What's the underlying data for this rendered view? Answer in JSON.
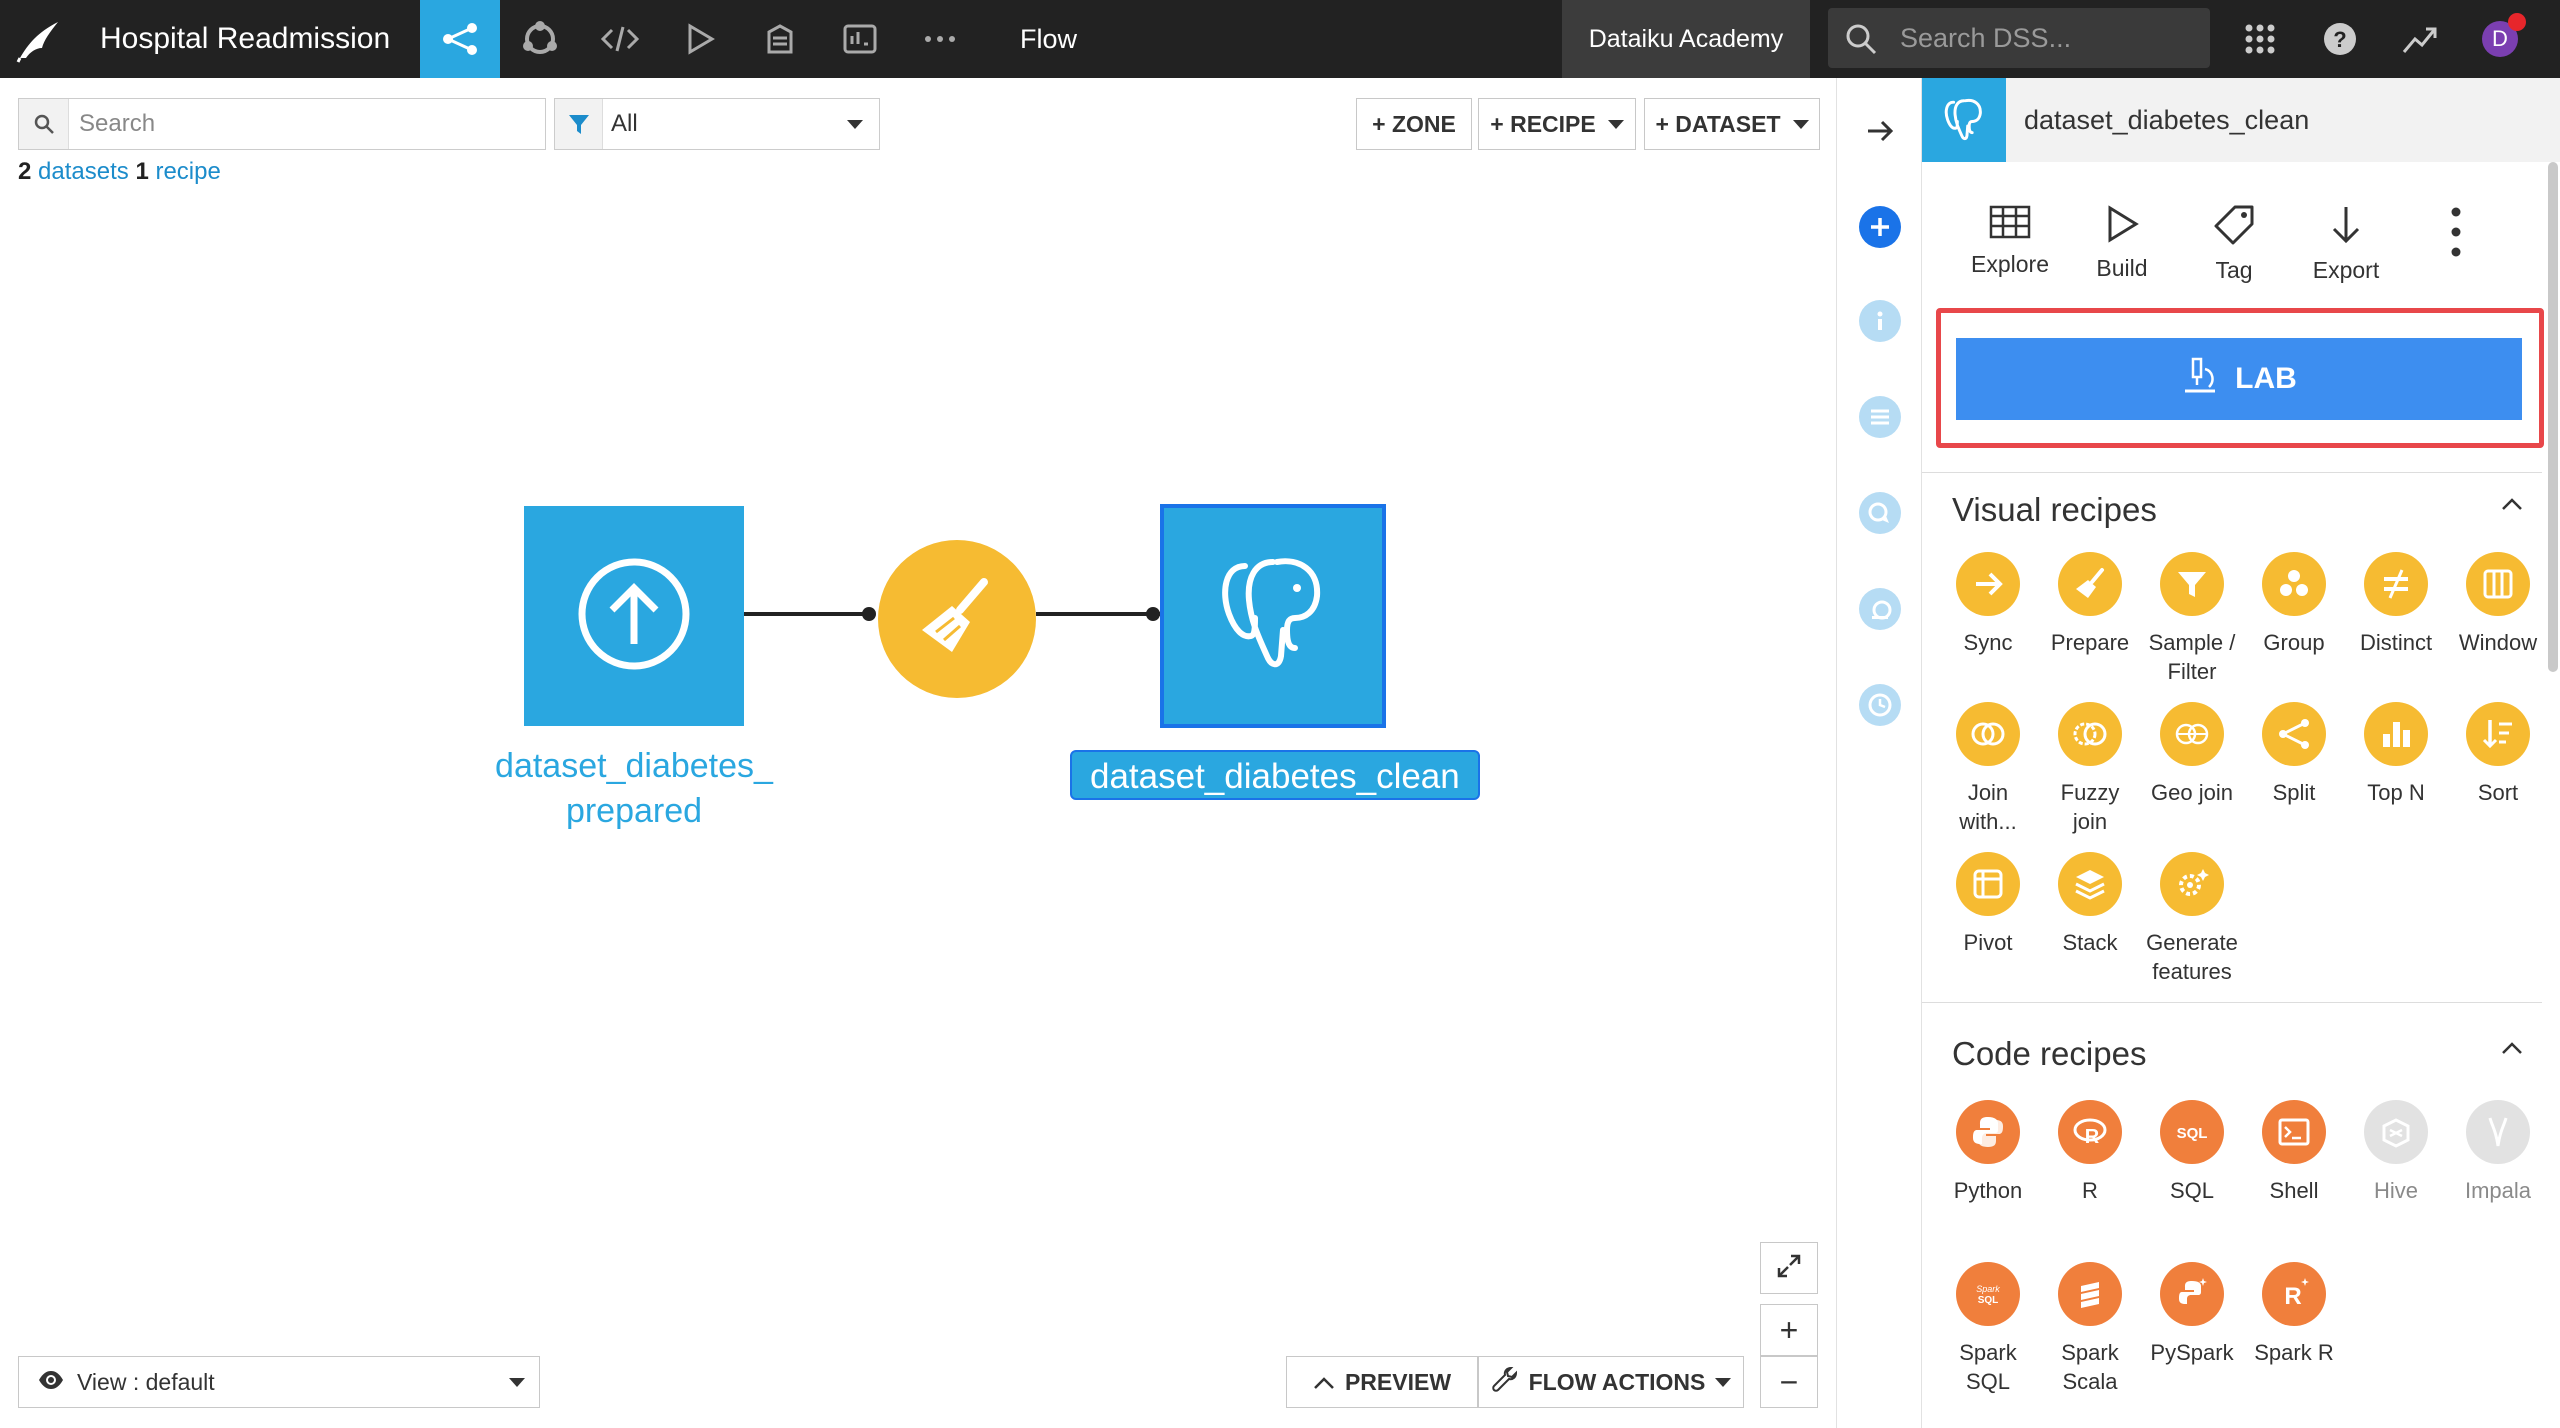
{
  "topbar": {
    "project_name": "Hospital Readmission",
    "section_label": "Flow",
    "instance_label": "Dataiku Academy",
    "search_placeholder": "Search DSS...",
    "avatar_initial": "D"
  },
  "flow_toolbar": {
    "search_placeholder": "Search",
    "filter_value": "All",
    "zone_button": "+ ZONE",
    "recipe_button": "+ RECIPE",
    "dataset_button": "+ DATASET"
  },
  "counts": {
    "datasets_count": "2",
    "datasets_label": "datasets",
    "recipes_count": "1",
    "recipes_label": "recipe"
  },
  "flow": {
    "input_dataset_label": "dataset_diabetes_\nprepared",
    "output_dataset_label": "dataset_diabetes_clean"
  },
  "bottom": {
    "view_label": "View : default",
    "preview_button": "PREVIEW",
    "flow_actions_button": "FLOW ACTIONS",
    "zoom_in": "+",
    "zoom_out": "−"
  },
  "panel": {
    "title": "dataset_diabetes_clean",
    "actions": [
      {
        "label": "Explore",
        "icon": "table-icon"
      },
      {
        "label": "Build",
        "icon": "play-icon"
      },
      {
        "label": "Tag",
        "icon": "tag-icon"
      },
      {
        "label": "Export",
        "icon": "arrow-down-icon"
      }
    ],
    "lab_button": "LAB",
    "visual_recipes_title": "Visual recipes",
    "visual_recipes": [
      {
        "label": "Sync",
        "icon": "arrow-right-icon"
      },
      {
        "label": "Prepare",
        "icon": "broom-icon"
      },
      {
        "label": "Sample /\nFilter",
        "icon": "funnel-icon"
      },
      {
        "label": "Group",
        "icon": "group-icon"
      },
      {
        "label": "Distinct",
        "icon": "not-equal-icon"
      },
      {
        "label": "Window",
        "icon": "window-icon"
      },
      {
        "label": "Join\nwith...",
        "icon": "join-icon"
      },
      {
        "label": "Fuzzy\njoin",
        "icon": "fuzzy-join-icon"
      },
      {
        "label": "Geo join",
        "icon": "globe-icon"
      },
      {
        "label": "Split",
        "icon": "split-icon"
      },
      {
        "label": "Top N",
        "icon": "top-n-icon"
      },
      {
        "label": "Sort",
        "icon": "sort-icon"
      },
      {
        "label": "Pivot",
        "icon": "pivot-icon"
      },
      {
        "label": "Stack",
        "icon": "stack-icon"
      },
      {
        "label": "Generate\nfeatures",
        "icon": "gear-sparkle-icon"
      }
    ],
    "code_recipes_title": "Code recipes",
    "code_recipes": [
      {
        "label": "Python",
        "icon": "python-icon",
        "glyph": "",
        "enabled": true
      },
      {
        "label": "R",
        "icon": "r-icon",
        "glyph": "R",
        "enabled": true
      },
      {
        "label": "SQL",
        "icon": "sql-icon",
        "glyph": "SQL",
        "enabled": true
      },
      {
        "label": "Shell",
        "icon": "shell-icon",
        "glyph": "",
        "enabled": true
      },
      {
        "label": "Hive",
        "icon": "hive-icon",
        "glyph": "",
        "enabled": false
      },
      {
        "label": "Impala",
        "icon": "impala-icon",
        "glyph": "",
        "enabled": false
      },
      {
        "label": "Spark\nSQL",
        "icon": "spark-sql-icon",
        "glyph": "Spark\nSQL",
        "enabled": true
      },
      {
        "label": "Spark\nScala",
        "icon": "spark-scala-icon",
        "glyph": "",
        "enabled": true
      },
      {
        "label": "PySpark",
        "icon": "pyspark-icon",
        "glyph": "",
        "enabled": true
      },
      {
        "label": "Spark R",
        "icon": "spark-r-icon",
        "glyph": "R",
        "enabled": true
      }
    ]
  },
  "colors": {
    "accent_blue": "#2aa7e0",
    "lab_blue": "#3d8ef0",
    "visual_recipe": "#f6bb32",
    "code_recipe": "#f07f3c",
    "highlight_red": "#e8474a",
    "topbar_bg": "#222222"
  }
}
